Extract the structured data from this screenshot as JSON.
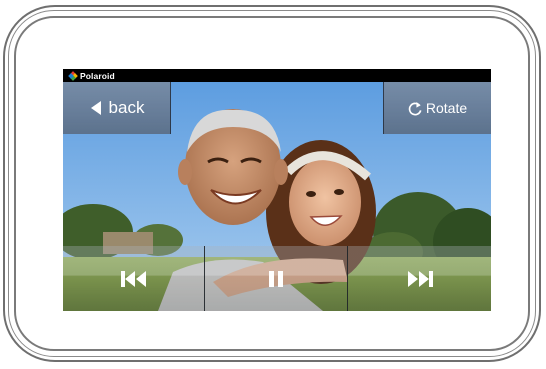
{
  "brand": {
    "name": "Polaroid"
  },
  "header": {
    "back_label": "back",
    "rotate_label": "Rotate"
  },
  "controls": {
    "prev_icon": "skip-previous-icon",
    "pause_icon": "pause-icon",
    "next_icon": "skip-next-icon"
  },
  "colors": {
    "bar_blue": "#5f7796",
    "frame": "#7a7a7a",
    "sky": "#6fa7e0",
    "grass": "#8aa84a"
  }
}
